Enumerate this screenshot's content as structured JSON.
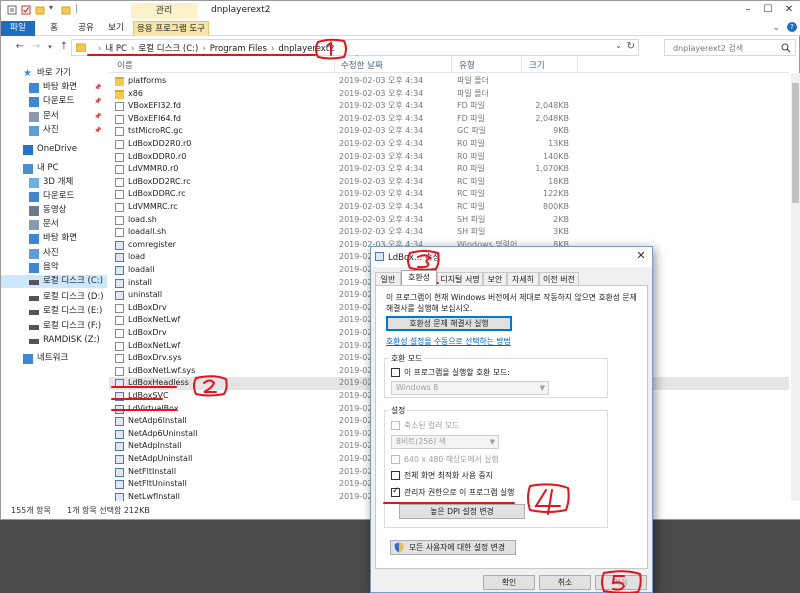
{
  "explorer": {
    "ribbon_tabs": [
      "파일",
      "홈",
      "공유",
      "보기",
      "응용 프로그램 도구"
    ],
    "context_tab": "관리",
    "window_title": "dnplayerext2",
    "breadcrumbs": [
      "내 PC",
      "로컬 디스크 (C:)",
      "Program Files",
      "dnplayerext2"
    ],
    "search_placeholder": "dnplayerext2 검색",
    "columns": [
      "이름",
      "수정한 날짜",
      "유형",
      "크기"
    ],
    "files": [
      {
        "name": "platforms",
        "date": "2019-02-03 오후 4:34",
        "type": "파일 폴더",
        "size": "",
        "icon": "folder"
      },
      {
        "name": "x86",
        "date": "2019-02-03 오후 4:34",
        "type": "파일 폴더",
        "size": "",
        "icon": "folder"
      },
      {
        "name": "VBoxEFI32.fd",
        "date": "2019-02-03 오후 4:34",
        "type": "FD 파일",
        "size": "2,048KB",
        "icon": "file"
      },
      {
        "name": "VBoxEFI64.fd",
        "date": "2019-02-03 오후 4:34",
        "type": "FD 파일",
        "size": "2,048KB",
        "icon": "file"
      },
      {
        "name": "tstMicroRC.gc",
        "date": "2019-02-03 오후 4:34",
        "type": "GC 파일",
        "size": "9KB",
        "icon": "file"
      },
      {
        "name": "LdBoxDD2R0.r0",
        "date": "2019-02-03 오후 4:34",
        "type": "R0 파일",
        "size": "13KB",
        "icon": "file"
      },
      {
        "name": "LdBoxDDR0.r0",
        "date": "2019-02-03 오후 4:34",
        "type": "R0 파일",
        "size": "140KB",
        "icon": "file"
      },
      {
        "name": "LdVMMR0.r0",
        "date": "2019-02-03 오후 4:34",
        "type": "R0 파일",
        "size": "1,070KB",
        "icon": "file"
      },
      {
        "name": "LdBoxDD2RC.rc",
        "date": "2019-02-03 오후 4:34",
        "type": "RC 파일",
        "size": "18KB",
        "icon": "file"
      },
      {
        "name": "LdBoxDDRC.rc",
        "date": "2019-02-03 오후 4:34",
        "type": "RC 파일",
        "size": "122KB",
        "icon": "file"
      },
      {
        "name": "LdVMMRC.rc",
        "date": "2019-02-03 오후 4:34",
        "type": "RC 파일",
        "size": "800KB",
        "icon": "file"
      },
      {
        "name": "load.sh",
        "date": "2019-02-03 오후 4:34",
        "type": "SH 파일",
        "size": "2KB",
        "icon": "file"
      },
      {
        "name": "loadall.sh",
        "date": "2019-02-03 오후 4:34",
        "type": "SH 파일",
        "size": "3KB",
        "icon": "file"
      },
      {
        "name": "comregister",
        "date": "2019-02-03 오후 4:34",
        "type": "Windows 명령어",
        "size": "8KB",
        "icon": "exe"
      },
      {
        "name": "load",
        "date": "2019-02-03",
        "type": "",
        "size": "",
        "icon": "exe"
      },
      {
        "name": "loadall",
        "date": "2019-02-03",
        "type": "",
        "size": "",
        "icon": "exe"
      },
      {
        "name": "install",
        "date": "2019-02-03",
        "type": "",
        "size": "",
        "icon": "exe"
      },
      {
        "name": "uninstall",
        "date": "2019-02-03",
        "type": "",
        "size": "",
        "icon": "exe"
      },
      {
        "name": "LdBoxDrv",
        "date": "2019-02-03",
        "type": "",
        "size": "",
        "icon": "file"
      },
      {
        "name": "LdBoxNetLwf",
        "date": "2019-02-03",
        "type": "",
        "size": "",
        "icon": "file"
      },
      {
        "name": "LdBoxDrv",
        "date": "2019-02-03",
        "type": "",
        "size": "",
        "icon": "file"
      },
      {
        "name": "LdBoxNetLwf",
        "date": "2019-02-03",
        "type": "",
        "size": "",
        "icon": "file"
      },
      {
        "name": "LdBoxDrv.sys",
        "date": "2019-02-03",
        "type": "",
        "size": "",
        "icon": "file"
      },
      {
        "name": "LdBoxNetLwf.sys",
        "date": "2019-02-03",
        "type": "",
        "size": "",
        "icon": "file"
      },
      {
        "name": "LdBoxHeadless",
        "date": "2019-02-03",
        "type": "",
        "size": "",
        "icon": "exe"
      },
      {
        "name": "LdBoxSVC",
        "date": "2019-02-03",
        "type": "",
        "size": "",
        "icon": "exe"
      },
      {
        "name": "LdVirtualBox",
        "date": "2019-02-03",
        "type": "",
        "size": "",
        "icon": "exe"
      },
      {
        "name": "NetAdp6Install",
        "date": "2019-02-03",
        "type": "",
        "size": "",
        "icon": "exe"
      },
      {
        "name": "NetAdp6Uninstall",
        "date": "2019-02-03",
        "type": "",
        "size": "",
        "icon": "exe"
      },
      {
        "name": "NetAdpInstall",
        "date": "2019-02-03",
        "type": "",
        "size": "",
        "icon": "exe"
      },
      {
        "name": "NetAdpUninstall",
        "date": "2019-02-03",
        "type": "",
        "size": "",
        "icon": "exe"
      },
      {
        "name": "NetFltInstall",
        "date": "2019-02-03",
        "type": "",
        "size": "",
        "icon": "exe"
      },
      {
        "name": "NetFltUninstall",
        "date": "2019-02-03",
        "type": "",
        "size": "",
        "icon": "exe"
      },
      {
        "name": "NetLwfInstall",
        "date": "2019-02-03",
        "type": "",
        "size": "",
        "icon": "exe"
      }
    ],
    "status_count": "155개 항목",
    "status_selected": "1개 항목 선택함 212KB"
  },
  "navpane": {
    "items": [
      {
        "label": "바로 가기",
        "icon": "star-icon",
        "level": 0,
        "pinned": false,
        "color": "#3b88d8"
      },
      {
        "label": "바탕 화면",
        "icon": "desktop-icon",
        "level": 1,
        "pinned": true,
        "color": "#3b88d8"
      },
      {
        "label": "다운로드",
        "icon": "download-icon",
        "level": 1,
        "pinned": true,
        "color": "#3b88d8"
      },
      {
        "label": "문서",
        "icon": "document-icon",
        "level": 1,
        "pinned": true,
        "color": "#8a9bb0"
      },
      {
        "label": "사진",
        "icon": "picture-icon",
        "level": 1,
        "pinned": true,
        "color": "#5aa0d8"
      },
      {
        "label": "OneDrive",
        "icon": "cloud-icon",
        "level": 0,
        "pinned": false,
        "color": "#1e74c8"
      },
      {
        "label": "내 PC",
        "icon": "computer-icon",
        "level": 0,
        "pinned": false,
        "color": "#4a90d0"
      },
      {
        "label": "3D 개체",
        "icon": "cube-icon",
        "level": 1,
        "pinned": false,
        "color": "#6ab0e0"
      },
      {
        "label": "다운로드",
        "icon": "download-icon",
        "level": 1,
        "pinned": false,
        "color": "#3b88d8"
      },
      {
        "label": "동영상",
        "icon": "video-icon",
        "level": 1,
        "pinned": false,
        "color": "#6a7a8a"
      },
      {
        "label": "문서",
        "icon": "document-icon",
        "level": 1,
        "pinned": false,
        "color": "#8a9bb0"
      },
      {
        "label": "바탕 화면",
        "icon": "desktop-icon",
        "level": 1,
        "pinned": false,
        "color": "#3b88d8"
      },
      {
        "label": "사진",
        "icon": "picture-icon",
        "level": 1,
        "pinned": false,
        "color": "#5aa0d8"
      },
      {
        "label": "음악",
        "icon": "music-icon",
        "level": 1,
        "pinned": false,
        "color": "#3b88d8"
      },
      {
        "label": "로컬 디스크 (C:)",
        "icon": "drive-icon",
        "level": 1,
        "pinned": false,
        "color": "#555555",
        "selected": true
      },
      {
        "label": "로컬 디스크 (D:)",
        "icon": "drive-icon",
        "level": 1,
        "pinned": false,
        "color": "#555555"
      },
      {
        "label": "로컬 디스크 (E:)",
        "icon": "drive-icon",
        "level": 1,
        "pinned": false,
        "color": "#555555"
      },
      {
        "label": "로컬 디스크 (F:)",
        "icon": "drive-icon",
        "level": 1,
        "pinned": false,
        "color": "#555555"
      },
      {
        "label": "RAMDISK (Z:)",
        "icon": "drive-icon",
        "level": 1,
        "pinned": false,
        "color": "#555555"
      },
      {
        "label": "네트워크",
        "icon": "network-icon",
        "level": 0,
        "pinned": false,
        "color": "#3b88d8"
      }
    ]
  },
  "dialog": {
    "title": "LdBox... 속성",
    "tabs": [
      "일반",
      "호환성",
      "디지털 서명",
      "보안",
      "자세히",
      "이전 버전"
    ],
    "description": "이 프로그램이 현재 Windows 버전에서 제대로 작동하지 않으면 호환성 문제 해결사를 실행해 보십시오.",
    "troubleshooter_button": "호환성 문제 해결사 실행",
    "manual_link": "호환성 설정을 수동으로 선택하는 방법",
    "compat_mode_group": "호환 모드",
    "compat_mode_checkbox": "이 프로그램을 실행할 호환 모드:",
    "compat_mode_value": "Windows 8",
    "settings_group": "설정",
    "reduced_color_checkbox": "축소된 컬러 모드",
    "color_value": "8비트(256) 색",
    "res_checkbox": "640 x 480 해상도에서 실행",
    "fullscreen_checkbox": "전체 화면 최적화 사용 중지",
    "admin_checkbox": "관리자 권한으로 이 프로그램 실행",
    "dpi_button": "높은 DPI 설정 변경",
    "all_users_button": "모든 사용자에 대한 설정 변경",
    "ok_button": "확인",
    "cancel_button": "취소",
    "apply_button": "적용"
  },
  "annotations": {
    "color": "#e8101a"
  }
}
